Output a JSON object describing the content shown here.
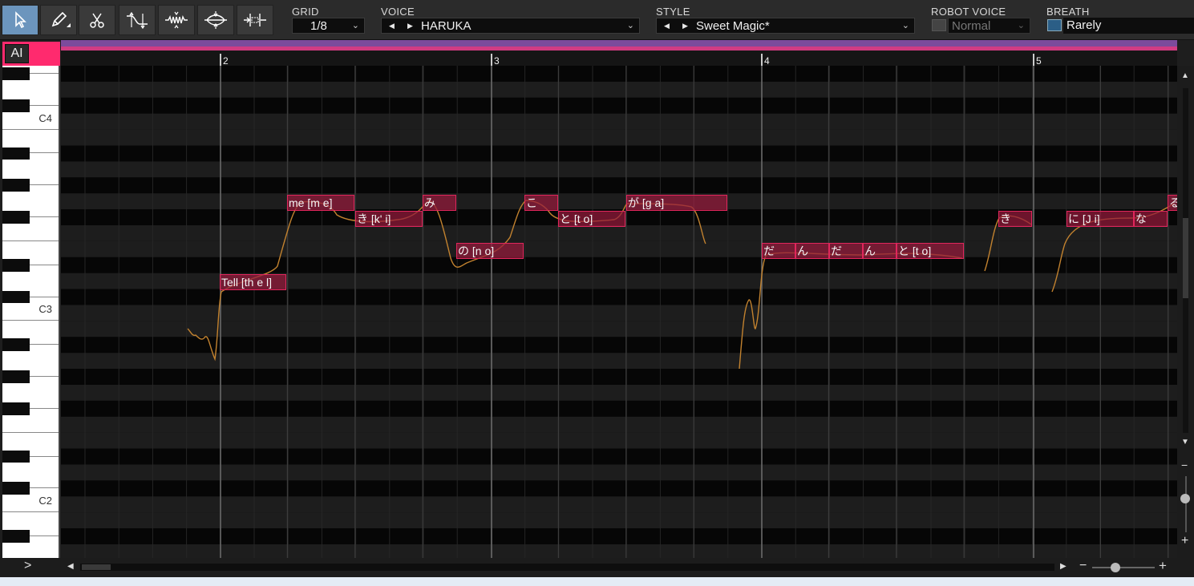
{
  "toolbar": {
    "tools": [
      {
        "name": "select-tool",
        "icon": "arrow-cursor-icon",
        "active": true
      },
      {
        "name": "pencil-tool",
        "icon": "pencil-icon"
      },
      {
        "name": "scissors-tool",
        "icon": "scissors-icon"
      },
      {
        "name": "pitch-curve-tool",
        "icon": "pitch-curve-icon"
      },
      {
        "name": "vibrato-tool",
        "icon": "vibrato-icon"
      },
      {
        "name": "volume-tool",
        "icon": "volume-shape-icon"
      },
      {
        "name": "timing-tool",
        "icon": "timing-icon"
      }
    ],
    "grid": {
      "label": "GRID",
      "value": "1/8"
    },
    "voice": {
      "label": "VOICE",
      "value": "HARUKA"
    },
    "style": {
      "label": "STYLE",
      "value": "Sweet Magic*"
    },
    "robot_voice": {
      "label": "ROBOT VOICE",
      "value": "Normal",
      "checked": false
    },
    "breath": {
      "label": "BREATH",
      "value": "Rarely",
      "checked": true
    }
  },
  "ai_button": {
    "label": "AI"
  },
  "piano": {
    "labels": [
      "C4",
      "C3",
      "C2"
    ]
  },
  "timeline": {
    "bars": [
      "2",
      "3",
      "4",
      "5"
    ]
  },
  "notes": [
    {
      "lyric": "Tell [th e l]"
    },
    {
      "lyric": "me [m e]"
    },
    {
      "lyric": "き [k' i]"
    },
    {
      "lyric": "み"
    },
    {
      "lyric": "の [n o]"
    },
    {
      "lyric": "こ"
    },
    {
      "lyric": "と [t o]"
    },
    {
      "lyric": "が [g a]"
    },
    {
      "lyric": "だ"
    },
    {
      "lyric": "ん"
    },
    {
      "lyric": "だ"
    },
    {
      "lyric": "ん"
    },
    {
      "lyric": "と [t o]"
    },
    {
      "lyric": "き"
    },
    {
      "lyric": "に [J i]"
    },
    {
      "lyric": "な"
    },
    {
      "lyric": "る"
    }
  ],
  "colors": {
    "accent_pink": "#ff2a6e",
    "note_fill": "#961a3c",
    "note_border": "#e0265c",
    "pitch_line": "#c2822f",
    "active_tool": "#6c95bd",
    "timebar_purple": "#7c4b9c"
  },
  "scroll": {
    "up": "▲",
    "down": "▼",
    "left": "◀",
    "right": "▶",
    "zoom_minus": "−",
    "zoom_plus": "+",
    "expand": ">"
  }
}
